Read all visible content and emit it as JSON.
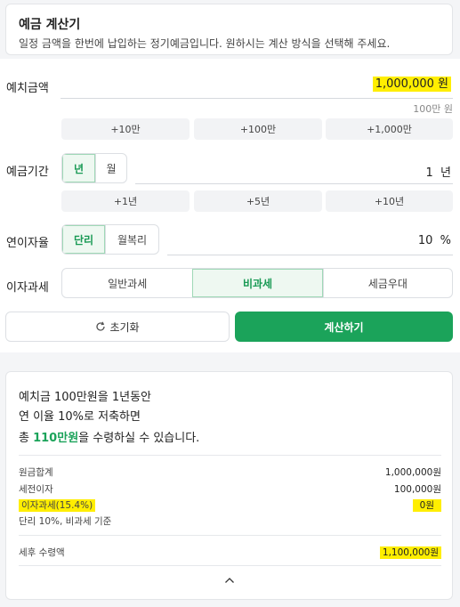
{
  "header": {
    "title": "예금 계산기",
    "description": "일정 금액을 한번에 납입하는 정기예금입니다. 원하시는 계산 방식을 선택해 주세요."
  },
  "deposit": {
    "label": "예치금액",
    "value": "1,000,000 원",
    "hint": "100만 원",
    "chips": [
      "+10만",
      "+100만",
      "+1,000만"
    ]
  },
  "period": {
    "label": "예금기간",
    "units": [
      "년",
      "월"
    ],
    "selected_unit": "년",
    "value": "1  년",
    "chips": [
      "+1년",
      "+5년",
      "+10년"
    ]
  },
  "rate": {
    "label": "연이자율",
    "types": [
      "단리",
      "월복리"
    ],
    "selected_type": "단리",
    "value": "10  %"
  },
  "tax": {
    "label": "이자과세",
    "options": [
      "일반과세",
      "비과세",
      "세금우대"
    ],
    "selected": "비과세"
  },
  "actions": {
    "reset_label": "초기화",
    "calc_label": "계산하기"
  },
  "result": {
    "line1": "예치금 100만원을 1년동안",
    "line2": "연 이율 10%로 저축하면",
    "line3_prefix": "총 ",
    "line3_amount": "110만원",
    "line3_suffix": "을 수령하실 수 있습니다.",
    "rows": [
      {
        "label": "원금합계",
        "value": "1,000,000원"
      },
      {
        "label": "세전이자",
        "value": "100,000원"
      },
      {
        "label": "이자과세(15.4%)",
        "value": "0원"
      }
    ],
    "note": "단리 10%, 비과세 기준",
    "total_label": "세후 수령액",
    "total_value": "1,100,000원"
  },
  "colors": {
    "accent": "#1ba35a",
    "highlight": "#ffee00"
  }
}
